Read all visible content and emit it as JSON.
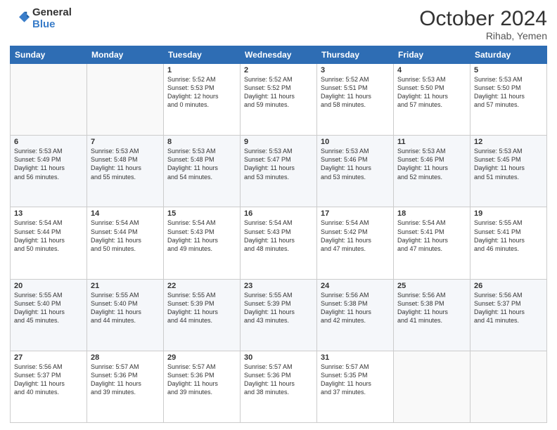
{
  "logo": {
    "general": "General",
    "blue": "Blue"
  },
  "header": {
    "month": "October 2024",
    "location": "Rihab, Yemen"
  },
  "weekdays": [
    "Sunday",
    "Monday",
    "Tuesday",
    "Wednesday",
    "Thursday",
    "Friday",
    "Saturday"
  ],
  "weeks": [
    [
      {
        "day": "",
        "info": ""
      },
      {
        "day": "",
        "info": ""
      },
      {
        "day": "1",
        "info": "Sunrise: 5:52 AM\nSunset: 5:53 PM\nDaylight: 12 hours\nand 0 minutes."
      },
      {
        "day": "2",
        "info": "Sunrise: 5:52 AM\nSunset: 5:52 PM\nDaylight: 11 hours\nand 59 minutes."
      },
      {
        "day": "3",
        "info": "Sunrise: 5:52 AM\nSunset: 5:51 PM\nDaylight: 11 hours\nand 58 minutes."
      },
      {
        "day": "4",
        "info": "Sunrise: 5:53 AM\nSunset: 5:50 PM\nDaylight: 11 hours\nand 57 minutes."
      },
      {
        "day": "5",
        "info": "Sunrise: 5:53 AM\nSunset: 5:50 PM\nDaylight: 11 hours\nand 57 minutes."
      }
    ],
    [
      {
        "day": "6",
        "info": "Sunrise: 5:53 AM\nSunset: 5:49 PM\nDaylight: 11 hours\nand 56 minutes."
      },
      {
        "day": "7",
        "info": "Sunrise: 5:53 AM\nSunset: 5:48 PM\nDaylight: 11 hours\nand 55 minutes."
      },
      {
        "day": "8",
        "info": "Sunrise: 5:53 AM\nSunset: 5:48 PM\nDaylight: 11 hours\nand 54 minutes."
      },
      {
        "day": "9",
        "info": "Sunrise: 5:53 AM\nSunset: 5:47 PM\nDaylight: 11 hours\nand 53 minutes."
      },
      {
        "day": "10",
        "info": "Sunrise: 5:53 AM\nSunset: 5:46 PM\nDaylight: 11 hours\nand 53 minutes."
      },
      {
        "day": "11",
        "info": "Sunrise: 5:53 AM\nSunset: 5:46 PM\nDaylight: 11 hours\nand 52 minutes."
      },
      {
        "day": "12",
        "info": "Sunrise: 5:53 AM\nSunset: 5:45 PM\nDaylight: 11 hours\nand 51 minutes."
      }
    ],
    [
      {
        "day": "13",
        "info": "Sunrise: 5:54 AM\nSunset: 5:44 PM\nDaylight: 11 hours\nand 50 minutes."
      },
      {
        "day": "14",
        "info": "Sunrise: 5:54 AM\nSunset: 5:44 PM\nDaylight: 11 hours\nand 50 minutes."
      },
      {
        "day": "15",
        "info": "Sunrise: 5:54 AM\nSunset: 5:43 PM\nDaylight: 11 hours\nand 49 minutes."
      },
      {
        "day": "16",
        "info": "Sunrise: 5:54 AM\nSunset: 5:43 PM\nDaylight: 11 hours\nand 48 minutes."
      },
      {
        "day": "17",
        "info": "Sunrise: 5:54 AM\nSunset: 5:42 PM\nDaylight: 11 hours\nand 47 minutes."
      },
      {
        "day": "18",
        "info": "Sunrise: 5:54 AM\nSunset: 5:41 PM\nDaylight: 11 hours\nand 47 minutes."
      },
      {
        "day": "19",
        "info": "Sunrise: 5:55 AM\nSunset: 5:41 PM\nDaylight: 11 hours\nand 46 minutes."
      }
    ],
    [
      {
        "day": "20",
        "info": "Sunrise: 5:55 AM\nSunset: 5:40 PM\nDaylight: 11 hours\nand 45 minutes."
      },
      {
        "day": "21",
        "info": "Sunrise: 5:55 AM\nSunset: 5:40 PM\nDaylight: 11 hours\nand 44 minutes."
      },
      {
        "day": "22",
        "info": "Sunrise: 5:55 AM\nSunset: 5:39 PM\nDaylight: 11 hours\nand 44 minutes."
      },
      {
        "day": "23",
        "info": "Sunrise: 5:55 AM\nSunset: 5:39 PM\nDaylight: 11 hours\nand 43 minutes."
      },
      {
        "day": "24",
        "info": "Sunrise: 5:56 AM\nSunset: 5:38 PM\nDaylight: 11 hours\nand 42 minutes."
      },
      {
        "day": "25",
        "info": "Sunrise: 5:56 AM\nSunset: 5:38 PM\nDaylight: 11 hours\nand 41 minutes."
      },
      {
        "day": "26",
        "info": "Sunrise: 5:56 AM\nSunset: 5:37 PM\nDaylight: 11 hours\nand 41 minutes."
      }
    ],
    [
      {
        "day": "27",
        "info": "Sunrise: 5:56 AM\nSunset: 5:37 PM\nDaylight: 11 hours\nand 40 minutes."
      },
      {
        "day": "28",
        "info": "Sunrise: 5:57 AM\nSunset: 5:36 PM\nDaylight: 11 hours\nand 39 minutes."
      },
      {
        "day": "29",
        "info": "Sunrise: 5:57 AM\nSunset: 5:36 PM\nDaylight: 11 hours\nand 39 minutes."
      },
      {
        "day": "30",
        "info": "Sunrise: 5:57 AM\nSunset: 5:36 PM\nDaylight: 11 hours\nand 38 minutes."
      },
      {
        "day": "31",
        "info": "Sunrise: 5:57 AM\nSunset: 5:35 PM\nDaylight: 11 hours\nand 37 minutes."
      },
      {
        "day": "",
        "info": ""
      },
      {
        "day": "",
        "info": ""
      }
    ]
  ]
}
